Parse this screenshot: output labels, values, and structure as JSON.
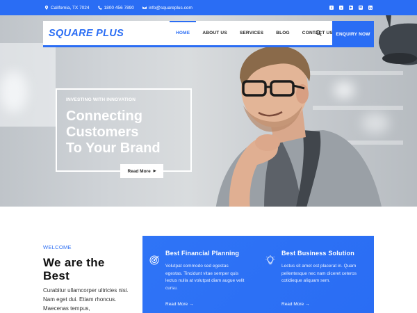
{
  "topbar": {
    "location": "California, TX 7024",
    "phone": "1800 456 7890",
    "email": "info@squareplus.com",
    "social_icons": [
      "facebook-icon",
      "twitter-icon",
      "youtube-icon",
      "mail-icon",
      "linkedin-icon"
    ]
  },
  "nav": {
    "logo": "SQUARE PLUS",
    "items": [
      "HOME",
      "ABOUT US",
      "SERVICES",
      "BLOG",
      "CONTACT US"
    ],
    "active": "HOME",
    "enquiry": "ENQUIRY NOW"
  },
  "hero": {
    "eyebrow": "INVESTING WITH INNOVATION",
    "headline": [
      "Connecting",
      "Customers",
      "To Your Brand"
    ],
    "button": "Read More"
  },
  "welcome": {
    "label": "WELCOME",
    "title": "We are the Best",
    "text": "Curabitur ullamcorper ultricies nisi. Nam eget dui. Etiam rhoncus. Maecenas tempus,"
  },
  "services": [
    {
      "icon": "target-icon",
      "title": "Best Financial Planning",
      "text": "Volutpat commodo sed egestas egestas. Tincidunt vitae semper quis lectus nulla at volutpat diam augue velit cursu.",
      "link": "Read More →"
    },
    {
      "icon": "lightbulb-icon",
      "title": "Best Business Solution",
      "text": "Lectus sit amet est placerat in. Quam pellentesque nec nam diceret ceteros cotidieque aliquam sem.",
      "link": "Read More →"
    }
  ],
  "colors": {
    "accent": "#2a6df4",
    "white": "#ffffff",
    "text": "#222222"
  }
}
